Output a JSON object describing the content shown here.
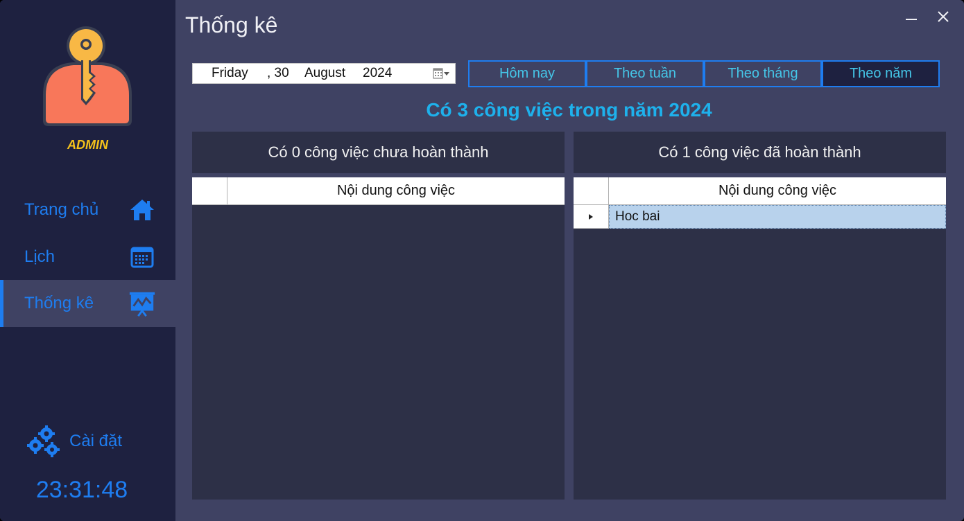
{
  "app": {
    "role": "ADMIN"
  },
  "header": {
    "title": "Thống kê"
  },
  "sidebar": {
    "items": [
      {
        "label": "Trang chủ",
        "icon": "home-icon"
      },
      {
        "label": "Lịch",
        "icon": "calendar-icon"
      },
      {
        "label": "Thống kê",
        "icon": "chart-board-icon",
        "active": true
      }
    ],
    "settings_label": "Cài đặt",
    "clock": "23:31:48"
  },
  "date_picker": {
    "weekday": "Friday",
    "day": ", 30",
    "month": "August",
    "year": "2024"
  },
  "filters": [
    {
      "label": "Hôm nay"
    },
    {
      "label": "Theo tuần"
    },
    {
      "label": "Theo tháng"
    },
    {
      "label": "Theo năm",
      "active": true
    }
  ],
  "summary": "Có 3 công việc trong năm 2024",
  "incomplete": {
    "title": "Có 0 công việc chưa hoàn thành",
    "column": "Nội dung công việc",
    "rows": []
  },
  "completed": {
    "title": "Có 1 công việc đã hoàn thành",
    "column": "Nội dung công việc",
    "rows": [
      "Hoc bai"
    ]
  },
  "colors": {
    "accent": "#1e7df0",
    "sidebar_bg": "#1e2140",
    "main_bg": "#3f4263",
    "panel_bg": "#2d3047",
    "role_gold": "#f5c21b",
    "summary_cyan": "#1eb1ec",
    "selected_row": "#b8d2ec"
  }
}
